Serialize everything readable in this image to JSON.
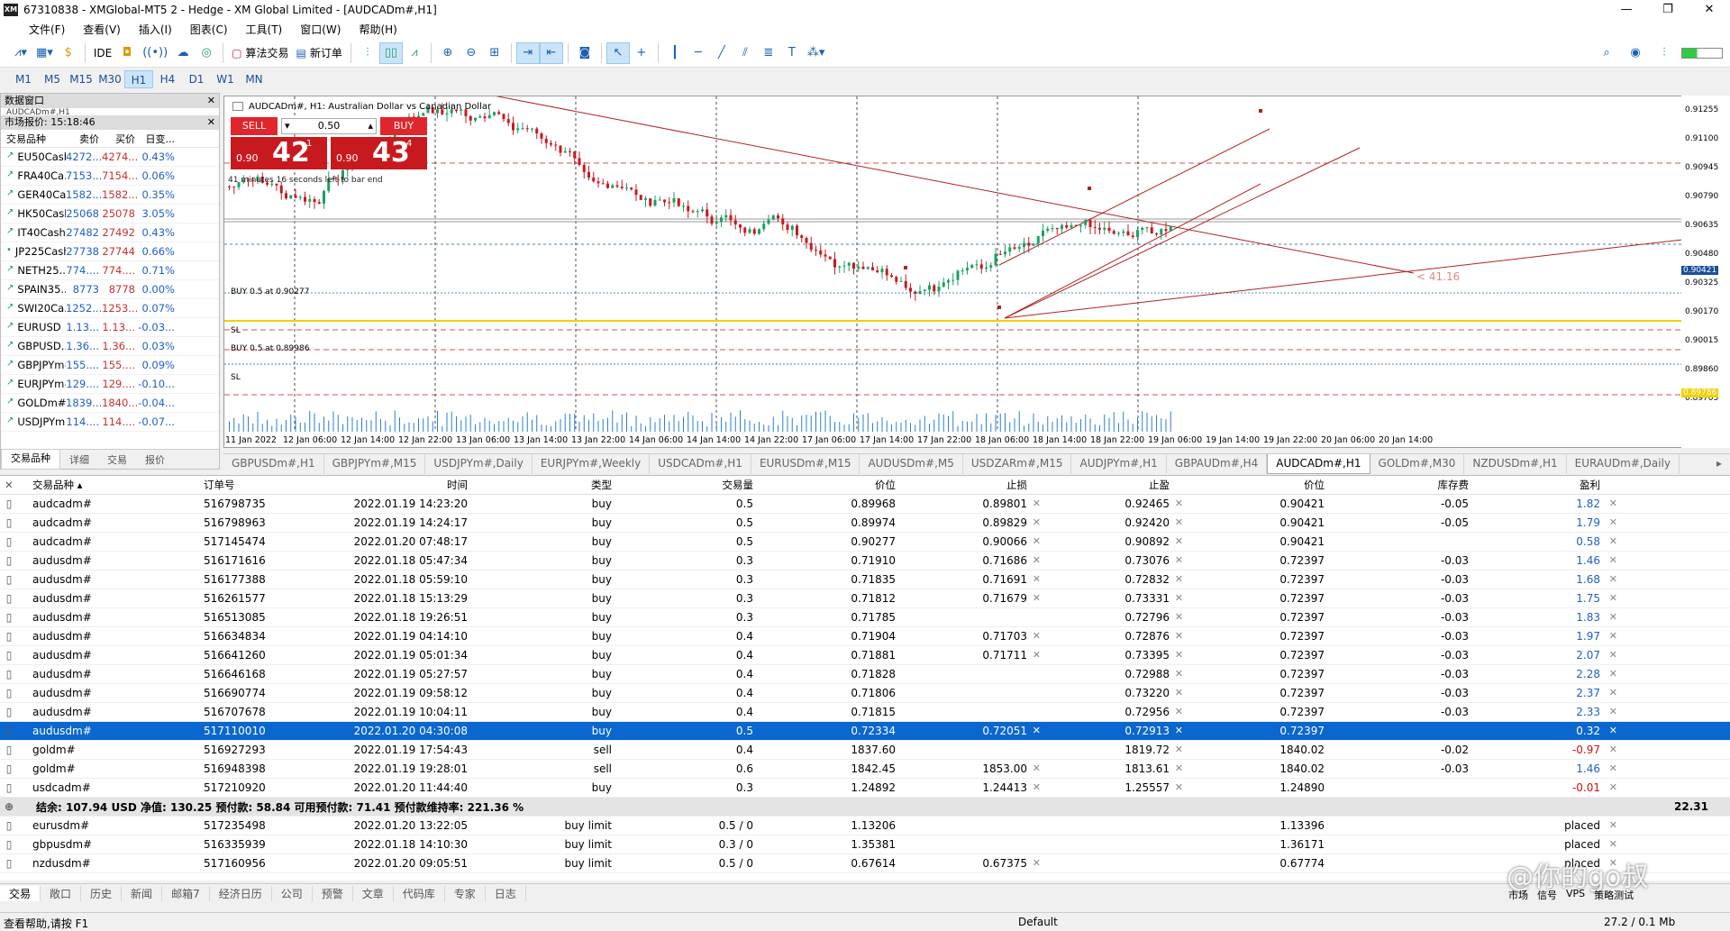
{
  "window": {
    "title": "67310838 - XMGlobal-MT5 2 - Hedge - XM Global Limited - [AUDCADm#,H1]",
    "app_icon": "XM"
  },
  "menu": [
    "文件(F)",
    "查看(V)",
    "插入(I)",
    "图表(C)",
    "工具(T)",
    "窗口(W)",
    "帮助(H)"
  ],
  "toolbar": {
    "algo_label": "算法交易",
    "new_order_label": "新订单",
    "ide_label": "IDE"
  },
  "timeframes": [
    "M1",
    "M5",
    "M15",
    "M30",
    "H1",
    "H4",
    "D1",
    "W1",
    "MN"
  ],
  "active_timeframe": "H1",
  "data_window": {
    "title": "数据窗口",
    "subtitle": "AUDCADm#,H1"
  },
  "market_watch": {
    "title": "市场报价: 15:18:46",
    "headers": [
      "交易品种",
      "卖价",
      "买价",
      "日变..."
    ],
    "rows": [
      {
        "sym": "EU50Cash",
        "bid": "4272...",
        "ask": "4274...",
        "chg": "0.43%",
        "dir": "up"
      },
      {
        "sym": "FRA40Ca...",
        "bid": "7153...",
        "ask": "7154...",
        "chg": "0.06%",
        "dir": "up"
      },
      {
        "sym": "GER40Ca...",
        "bid": "1582...",
        "ask": "1582...",
        "chg": "0.35%",
        "dir": "up"
      },
      {
        "sym": "HK50Cash",
        "bid": "25068",
        "ask": "25078",
        "chg": "3.05%",
        "dir": "up"
      },
      {
        "sym": "IT40Cash",
        "bid": "27482",
        "ask": "27492",
        "chg": "0.43%",
        "dir": "up"
      },
      {
        "sym": "JP225Cash",
        "bid": "27738",
        "ask": "27744",
        "chg": "0.66%",
        "dir": "flat"
      },
      {
        "sym": "NETH25...",
        "bid": "774....",
        "ask": "774....",
        "chg": "0.71%",
        "dir": "up"
      },
      {
        "sym": "SPAIN35...",
        "bid": "8773",
        "ask": "8778",
        "chg": "0.00%",
        "dir": "up"
      },
      {
        "sym": "SWI20Ca...",
        "bid": "1252...",
        "ask": "1253...",
        "chg": "0.07%",
        "dir": "up"
      },
      {
        "sym": "EURUSD",
        "bid": "1.13...",
        "ask": "1.13...",
        "chg": "-0.03...",
        "dir": "up"
      },
      {
        "sym": "GBPUSD...",
        "bid": "1.36...",
        "ask": "1.36...",
        "chg": "0.03%",
        "dir": "up"
      },
      {
        "sym": "GBPJPYm#",
        "bid": "155....",
        "ask": "155....",
        "chg": "0.09%",
        "dir": "up"
      },
      {
        "sym": "EURJPYm#",
        "bid": "129....",
        "ask": "129....",
        "chg": "-0.10...",
        "dir": "up"
      },
      {
        "sym": "GOLDm#",
        "bid": "1839...",
        "ask": "1840...",
        "chg": "-0.04...",
        "dir": "up"
      },
      {
        "sym": "USDJPYm#",
        "bid": "114....",
        "ask": "114....",
        "chg": "-0.07...",
        "dir": "up"
      }
    ],
    "tabs": [
      "交易品种",
      "详细",
      "交易",
      "报价"
    ]
  },
  "chart": {
    "title": "AUDCADm#, H1:  Australian Dollar vs Canadian Dollar",
    "sell_label": "SELL",
    "buy_label": "BUY",
    "lot": "0.50",
    "sell_small": "0.90",
    "sell_big": "42",
    "sell_pip": "1",
    "buy_small": "0.90",
    "buy_big": "43",
    "buy_pip": "4",
    "bars_left": "41 minutes 16 seconds left to bar end",
    "label_buy1": "BUY 0.5 at 0.90277",
    "label_buy2": "BUY 0.5 at 0.89986",
    "label_sl1": "SL",
    "label_sl2": "SL",
    "ptext": "< 41.16",
    "price_current": "0.90421",
    "price_yellow": "0.89786",
    "y_labels": [
      "0.91255",
      "0.91100",
      "0.90945",
      "0.90790",
      "0.90635",
      "0.90480",
      "0.90325",
      "0.90170",
      "0.90015",
      "0.89860",
      "0.89705"
    ],
    "x_labels": [
      "11 Jan 2022",
      "12 Jan 06:00",
      "12 Jan 14:00",
      "12 Jan 22:00",
      "13 Jan 06:00",
      "13 Jan 14:00",
      "13 Jan 22:00",
      "14 Jan 06:00",
      "14 Jan 14:00",
      "14 Jan 22:00",
      "17 Jan 06:00",
      "17 Jan 14:00",
      "17 Jan 22:00",
      "18 Jan 06:00",
      "18 Jan 14:00",
      "18 Jan 22:00",
      "19 Jan 06:00",
      "19 Jan 14:00",
      "19 Jan 22:00",
      "20 Jan 06:00",
      "20 Jan 14:00"
    ]
  },
  "chart_tabs": [
    "GBPUSDm#,H1",
    "GBPJPYm#,M15",
    "USDJPYm#,Daily",
    "EURJPYm#,Weekly",
    "USDCADm#,H1",
    "EURUSDm#,M15",
    "AUDUSDm#,M5",
    "USDZARm#,M15",
    "AUDJPYm#,H1",
    "GBPAUDm#,H4",
    "AUDCADm#,H1",
    "GOLDm#,M30",
    "NZDUSDm#,H1",
    "EURAUDm#,Daily"
  ],
  "active_chart_tab": "AUDCADm#,H1",
  "terminal": {
    "headers": [
      "交易品种",
      "订单号",
      "时间",
      "类型",
      "交易量",
      "价位",
      "止损",
      "止盈",
      "价位",
      "库存费",
      "盈利"
    ],
    "rows": [
      {
        "sym": "audcadm#",
        "order": "516798735",
        "time": "2022.01.19 14:23:20",
        "type": "buy",
        "vol": "0.5",
        "price": "0.89968",
        "sl": "0.89801",
        "tp": "0.92465",
        "cur": "0.90421",
        "swap": "-0.05",
        "profit": "1.82",
        "pc": "pos"
      },
      {
        "sym": "audcadm#",
        "order": "516798963",
        "time": "2022.01.19 14:24:17",
        "type": "buy",
        "vol": "0.5",
        "price": "0.89974",
        "sl": "0.89829",
        "tp": "0.92420",
        "cur": "0.90421",
        "swap": "-0.05",
        "profit": "1.79",
        "pc": "pos"
      },
      {
        "sym": "audcadm#",
        "order": "517145474",
        "time": "2022.01.20 07:48:17",
        "type": "buy",
        "vol": "0.5",
        "price": "0.90277",
        "sl": "0.90066",
        "tp": "0.90892",
        "cur": "0.90421",
        "swap": "",
        "profit": "0.58",
        "pc": "pos"
      },
      {
        "sym": "audusdm#",
        "order": "516171616",
        "time": "2022.01.18 05:47:34",
        "type": "buy",
        "vol": "0.3",
        "price": "0.71910",
        "sl": "0.71686",
        "tp": "0.73076",
        "cur": "0.72397",
        "swap": "-0.03",
        "profit": "1.46",
        "pc": "pos"
      },
      {
        "sym": "audusdm#",
        "order": "516177388",
        "time": "2022.01.18 05:59:10",
        "type": "buy",
        "vol": "0.3",
        "price": "0.71835",
        "sl": "0.71691",
        "tp": "0.72832",
        "cur": "0.72397",
        "swap": "-0.03",
        "profit": "1.68",
        "pc": "pos"
      },
      {
        "sym": "audusdm#",
        "order": "516261577",
        "time": "2022.01.18 15:13:29",
        "type": "buy",
        "vol": "0.3",
        "price": "0.71812",
        "sl": "0.71679",
        "tp": "0.73331",
        "cur": "0.72397",
        "swap": "-0.03",
        "profit": "1.75",
        "pc": "pos"
      },
      {
        "sym": "audusdm#",
        "order": "516513085",
        "time": "2022.01.18 19:26:51",
        "type": "buy",
        "vol": "0.3",
        "price": "0.71785",
        "sl": "",
        "tp": "0.72796",
        "cur": "0.72397",
        "swap": "-0.03",
        "profit": "1.83",
        "pc": "pos"
      },
      {
        "sym": "audusdm#",
        "order": "516634834",
        "time": "2022.01.19 04:14:10",
        "type": "buy",
        "vol": "0.4",
        "price": "0.71904",
        "sl": "0.71703",
        "tp": "0.72876",
        "cur": "0.72397",
        "swap": "-0.03",
        "profit": "1.97",
        "pc": "pos"
      },
      {
        "sym": "audusdm#",
        "order": "516641260",
        "time": "2022.01.19 05:01:34",
        "type": "buy",
        "vol": "0.4",
        "price": "0.71881",
        "sl": "0.71711",
        "tp": "0.73395",
        "cur": "0.72397",
        "swap": "-0.03",
        "profit": "2.07",
        "pc": "pos"
      },
      {
        "sym": "audusdm#",
        "order": "516646168",
        "time": "2022.01.19 05:27:57",
        "type": "buy",
        "vol": "0.4",
        "price": "0.71828",
        "sl": "",
        "tp": "0.72988",
        "cur": "0.72397",
        "swap": "-0.03",
        "profit": "2.28",
        "pc": "pos"
      },
      {
        "sym": "audusdm#",
        "order": "516690774",
        "time": "2022.01.19 09:58:12",
        "type": "buy",
        "vol": "0.4",
        "price": "0.71806",
        "sl": "",
        "tp": "0.73220",
        "cur": "0.72397",
        "swap": "-0.03",
        "profit": "2.37",
        "pc": "pos"
      },
      {
        "sym": "audusdm#",
        "order": "516707678",
        "time": "2022.01.19 10:04:11",
        "type": "buy",
        "vol": "0.4",
        "price": "0.71815",
        "sl": "",
        "tp": "0.72956",
        "cur": "0.72397",
        "swap": "-0.03",
        "profit": "2.33",
        "pc": "pos"
      },
      {
        "sym": "audusdm#",
        "order": "517110010",
        "time": "2022.01.20 04:30:08",
        "type": "buy",
        "vol": "0.5",
        "price": "0.72334",
        "sl": "0.72051",
        "tp": "0.72913",
        "cur": "0.72397",
        "swap": "",
        "profit": "0.32",
        "pc": "pos",
        "selected": true
      },
      {
        "sym": "goldm#",
        "order": "516927293",
        "time": "2022.01.19 17:54:43",
        "type": "sell",
        "vol": "0.4",
        "price": "1837.60",
        "sl": "",
        "tp": "1819.72",
        "cur": "1840.02",
        "swap": "-0.02",
        "profit": "-0.97",
        "pc": "neg"
      },
      {
        "sym": "goldm#",
        "order": "516948398",
        "time": "2022.01.19 19:28:01",
        "type": "sell",
        "vol": "0.6",
        "price": "1842.45",
        "sl": "1853.00",
        "tp": "1813.61",
        "cur": "1840.02",
        "swap": "-0.03",
        "profit": "1.46",
        "pc": "pos"
      },
      {
        "sym": "usdcadm#",
        "order": "517210920",
        "time": "2022.01.20 11:44:40",
        "type": "buy",
        "vol": "0.3",
        "price": "1.24892",
        "sl": "1.24413",
        "tp": "1.25557",
        "cur": "1.24890",
        "swap": "",
        "profit": "-0.01",
        "pc": "neg"
      }
    ],
    "summary": {
      "text": "结余: 107.94 USD  净值: 130.25  预付款: 58.84  可用预付款: 71.41  预付款维持率: 221.36 %",
      "total": "22.31"
    },
    "pending": [
      {
        "sym": "eurusdm#",
        "order": "517235498",
        "time": "2022.01.20 13:22:05",
        "type": "buy limit",
        "vol": "0.5 / 0",
        "price": "1.13206",
        "sl": "",
        "tp": "",
        "cur": "1.13396",
        "swap": "",
        "profit": "placed"
      },
      {
        "sym": "gbpusdm#",
        "order": "516335939",
        "time": "2022.01.18 14:10:30",
        "type": "buy limit",
        "vol": "0.3 / 0",
        "price": "1.35381",
        "sl": "",
        "tp": "",
        "cur": "1.36171",
        "swap": "",
        "profit": "placed"
      },
      {
        "sym": "nzdusdm#",
        "order": "517160956",
        "time": "2022.01.20 09:05:51",
        "type": "buy limit",
        "vol": "0.5 / 0",
        "price": "0.67614",
        "sl": "0.67375",
        "tp": "",
        "cur": "0.67774",
        "swap": "",
        "profit": "placed"
      }
    ],
    "tabs": [
      "交易",
      "敞口",
      "历史",
      "新闻",
      "邮箱7",
      "经济日历",
      "公司",
      "预警",
      "文章",
      "代码库",
      "专家",
      "日志"
    ]
  },
  "status": {
    "left": "查看帮助,请按 F1",
    "mid": "Default",
    "right": "27.2 / 0.1 Mb",
    "icons": [
      "市场",
      "信号",
      "VPS",
      "策略测试"
    ]
  },
  "watermark": "@你的go叔",
  "colors": {
    "bull": "#1f9e64",
    "bear": "#c8191f",
    "selected_row": "#0a67cf",
    "sell_buy": "#e0262b",
    "bid_text": "#1f5fc9",
    "ask_text": "#c83030"
  }
}
